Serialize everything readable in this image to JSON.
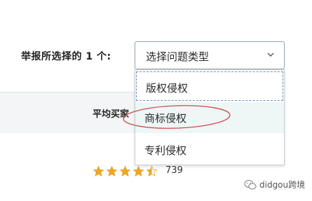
{
  "form": {
    "report_label": "举报所选择的 1 个:",
    "select_value": "选择问题类型"
  },
  "dropdown": {
    "options": [
      "版权侵权",
      "商标侵权",
      "专利侵权"
    ],
    "highlighted_option": "商标侵权"
  },
  "section": {
    "avg_label": "平均买家"
  },
  "rating": {
    "stars": 4.5,
    "max_stars": 5,
    "count": "739",
    "star_color": "#f0a81d"
  },
  "watermark": {
    "text": "didgou跨境",
    "icon": "wechat-icon"
  },
  "colors": {
    "highlight_ring": "#d24a4a",
    "option_hover_bg": "#eef6f6"
  }
}
